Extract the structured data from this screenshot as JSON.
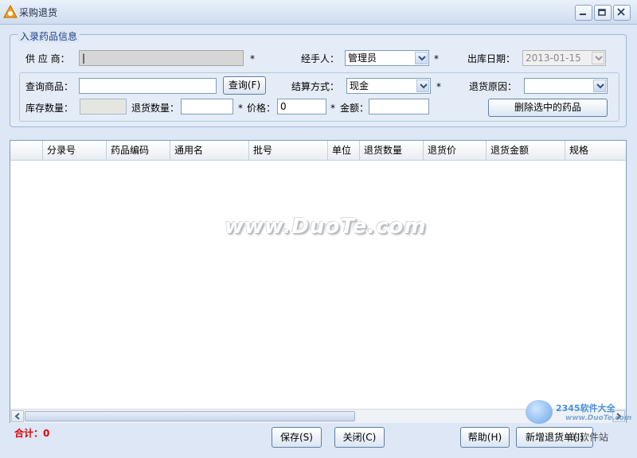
{
  "window": {
    "title": "采购退货"
  },
  "form": {
    "group_title": "入录药品信息",
    "supplier_label": "供 应 商：",
    "supplier_value": "|",
    "handler_label": "经手人：",
    "handler_value": "管理员",
    "date_label": "出库日期：",
    "date_value": "2013-01-15",
    "query_label": "查询商品：",
    "query_value": "",
    "query_button": "查询(F)",
    "settle_label": "结算方式：",
    "settle_value": "现金",
    "reason_label": "退货原因：",
    "reason_value": "",
    "stock_label": "库存数量：",
    "stock_value": "",
    "return_qty_label": "退货数量：",
    "return_qty_value": "",
    "price_label": "价格：",
    "price_value": "0",
    "amount_label": "金额：",
    "amount_value": "",
    "delete_button": "删除选中的药品",
    "required_mark": "*"
  },
  "table": {
    "columns": [
      "",
      "分录号",
      "药品编码",
      "通用名",
      "批号",
      "单位",
      "退货数量",
      "退货价",
      "退货金额",
      "规格"
    ],
    "rows": []
  },
  "watermark": "www.DuoTe.com",
  "footer": {
    "total": "合计：0",
    "save": "保存(S)",
    "close": "关闭(C)",
    "help": "帮助(H)",
    "new_order": "新增退货单(I)",
    "logo": "2345软件大全",
    "logo_sub": "www.DuoTe.com",
    "overlay": "的软件站"
  },
  "colors": {
    "accent": "#1c3f84",
    "total": "#e60000"
  }
}
